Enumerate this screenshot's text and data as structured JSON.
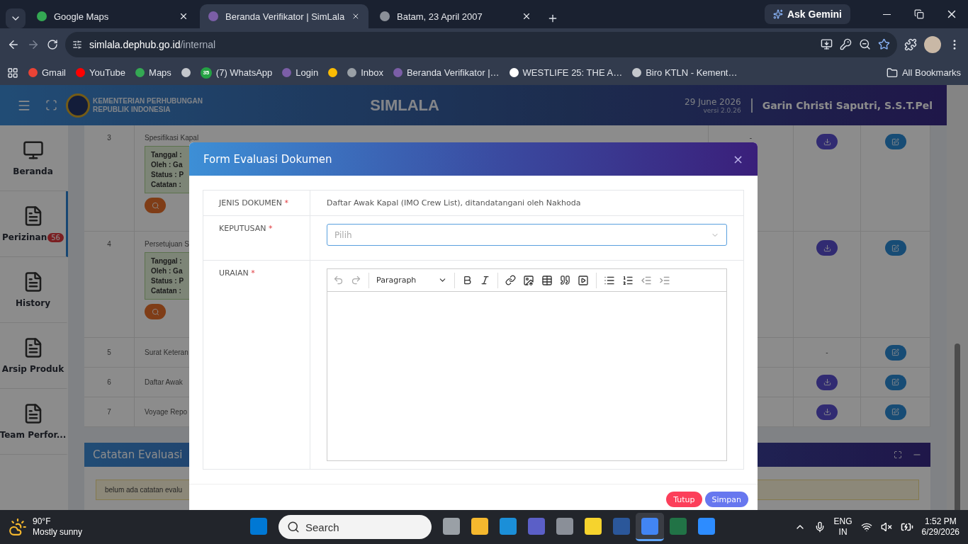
{
  "browser": {
    "tabs": [
      {
        "title": "Google Maps",
        "selected": false,
        "color": "#34a853"
      },
      {
        "title": "Beranda Verifikator | SimLala",
        "selected": true,
        "color": "#7b5ea7"
      },
      {
        "title": "Batam, 23 April 2007",
        "selected": false,
        "color": "#8a8f98"
      }
    ],
    "ask_gemini": "Ask Gemini",
    "url_host": "simlala.dephub.go.id",
    "url_path": "/internal",
    "bookmarks": [
      {
        "kind": "link",
        "label": "Gmail"
      },
      {
        "kind": "link",
        "label": "YouTube"
      },
      {
        "kind": "link",
        "label": "Maps"
      },
      {
        "kind": "icon"
      },
      {
        "kind": "badge",
        "label": "(7) WhatsApp",
        "badge": "35"
      },
      {
        "kind": "link",
        "label": "Login"
      },
      {
        "kind": "icon"
      },
      {
        "kind": "link",
        "label": "Inbox"
      },
      {
        "kind": "link",
        "label": "Beranda Verifikator |…"
      },
      {
        "kind": "link",
        "label": "WESTLIFE 25: THE A…"
      },
      {
        "kind": "link",
        "label": "Biro KTLN - Kement…"
      }
    ],
    "all_bookmarks": "All Bookmarks"
  },
  "header": {
    "org_lines": [
      "KEMENTERIAN PERHUBUNGAN",
      "REPUBLIK INDONESIA"
    ],
    "app_title": "SIMLALA",
    "date": "29 June 2026",
    "version": "versi 2.0.26",
    "user": "Garin Christi Saputri, S.S.T.Pel"
  },
  "sidebar": {
    "items": [
      {
        "label": "Beranda",
        "kind": "monitor",
        "selected": false
      },
      {
        "label": "Perizinan",
        "kind": "document",
        "badge": "56",
        "selected": true
      },
      {
        "label": "History",
        "kind": "document",
        "selected": false
      },
      {
        "label": "Arsip Produk",
        "kind": "document",
        "selected": false
      },
      {
        "label": "Team Perfor...",
        "kind": "document",
        "selected": false
      }
    ]
  },
  "table": {
    "rows": [
      {
        "no": "3",
        "name": "Spesifikasi Kapal",
        "kind": "detail",
        "details": [
          "Tanggal :",
          "Oleh : Ga",
          "Status : P",
          "Catatan :"
        ],
        "column_3": "-",
        "download": true
      },
      {
        "no": "4",
        "name": "Persetujuan S",
        "kind": "detail",
        "details": [
          "Tanggal :",
          "Oleh : Ga",
          "Status : P",
          "Catatan :"
        ],
        "download": true
      },
      {
        "no": "5",
        "name": "Surat Keteran",
        "kind": "plain",
        "download": false,
        "download_text": "-"
      },
      {
        "no": "6",
        "name": "Daftar Awak",
        "kind": "plain",
        "download": true
      },
      {
        "no": "7",
        "name": "Voyage Repo",
        "kind": "plain",
        "download": true
      }
    ]
  },
  "notes_panel": {
    "title": "Catatan Evaluasi",
    "message": "belum ada catatan evalu"
  },
  "modal": {
    "title": "Form Evaluasi Dokumen",
    "close": "×",
    "required_mark": "*",
    "fields": [
      {
        "label": "JENIS DOKUMEN",
        "required": true,
        "kind": "text",
        "value": "Daftar Awak Kapal (IMO Crew List), ditandatangani oleh Nakhoda"
      },
      {
        "label": "KEPUTUSAN",
        "required": true,
        "kind": "select",
        "placeholder": "Pilih"
      },
      {
        "label": "URAIAN",
        "required": true,
        "kind": "editor",
        "block_style": "Paragraph"
      }
    ],
    "buttons": [
      {
        "label": "Tutup",
        "kind": "danger"
      },
      {
        "label": "Simpan",
        "kind": "primary"
      }
    ]
  },
  "taskbar": {
    "temperature": "90°F",
    "weather": "Mostly sunny",
    "search_placeholder": "Search",
    "apps": [
      {
        "selected": false
      },
      {
        "selected": false
      },
      {
        "selected": false
      },
      {
        "selected": false
      },
      {
        "selected": false
      },
      {
        "selected": false
      },
      {
        "selected": false
      },
      {
        "selected": true
      },
      {
        "selected": false
      },
      {
        "selected": false
      }
    ],
    "language": "ENG",
    "region": "IN",
    "time": "1:52 PM",
    "date": "6/29/2026"
  }
}
